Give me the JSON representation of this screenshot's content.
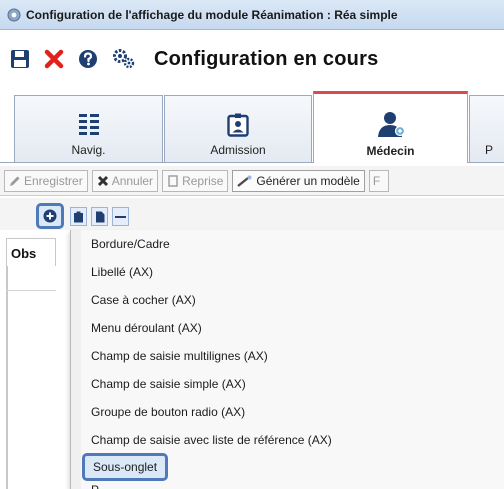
{
  "window": {
    "title": "Configuration de l'affichage du module Réanimation : Réa simple"
  },
  "toolbar": {
    "icons": [
      "save-icon",
      "close-icon",
      "help-icon",
      "settings-icon"
    ],
    "title": "Configuration en cours"
  },
  "tabs": [
    {
      "label": "Navig.",
      "icon": "list-icon"
    },
    {
      "label": "Admission",
      "icon": "badge-icon"
    },
    {
      "label": "Médecin",
      "icon": "doctor-icon",
      "active": true
    },
    {
      "label": "P",
      "icon": ""
    }
  ],
  "actions": {
    "save": "Enregistrer",
    "cancel": "Annuler",
    "resume": "Reprise",
    "generate": "Générer un modèle",
    "next_clipped": "F"
  },
  "left_panel": {
    "tab_label": "Obs"
  },
  "menu": {
    "items": [
      "Bordure/Cadre",
      "Libellé (AX)",
      "Case à cocher (AX)",
      "Menu déroulant (AX)",
      "Champ de saisie multilignes (AX)",
      "Champ de saisie simple (AX)",
      "Groupe de bouton radio (AX)",
      "Champ de saisie avec liste de référence (AX)"
    ],
    "highlighted_item": "Sous-onglet",
    "clipped_item": "P"
  },
  "colors": {
    "accent": "#4f79b8",
    "active_tab": "#d64d4d",
    "brand_red": "#e3201b",
    "brand_navy": "#1f3f73"
  }
}
